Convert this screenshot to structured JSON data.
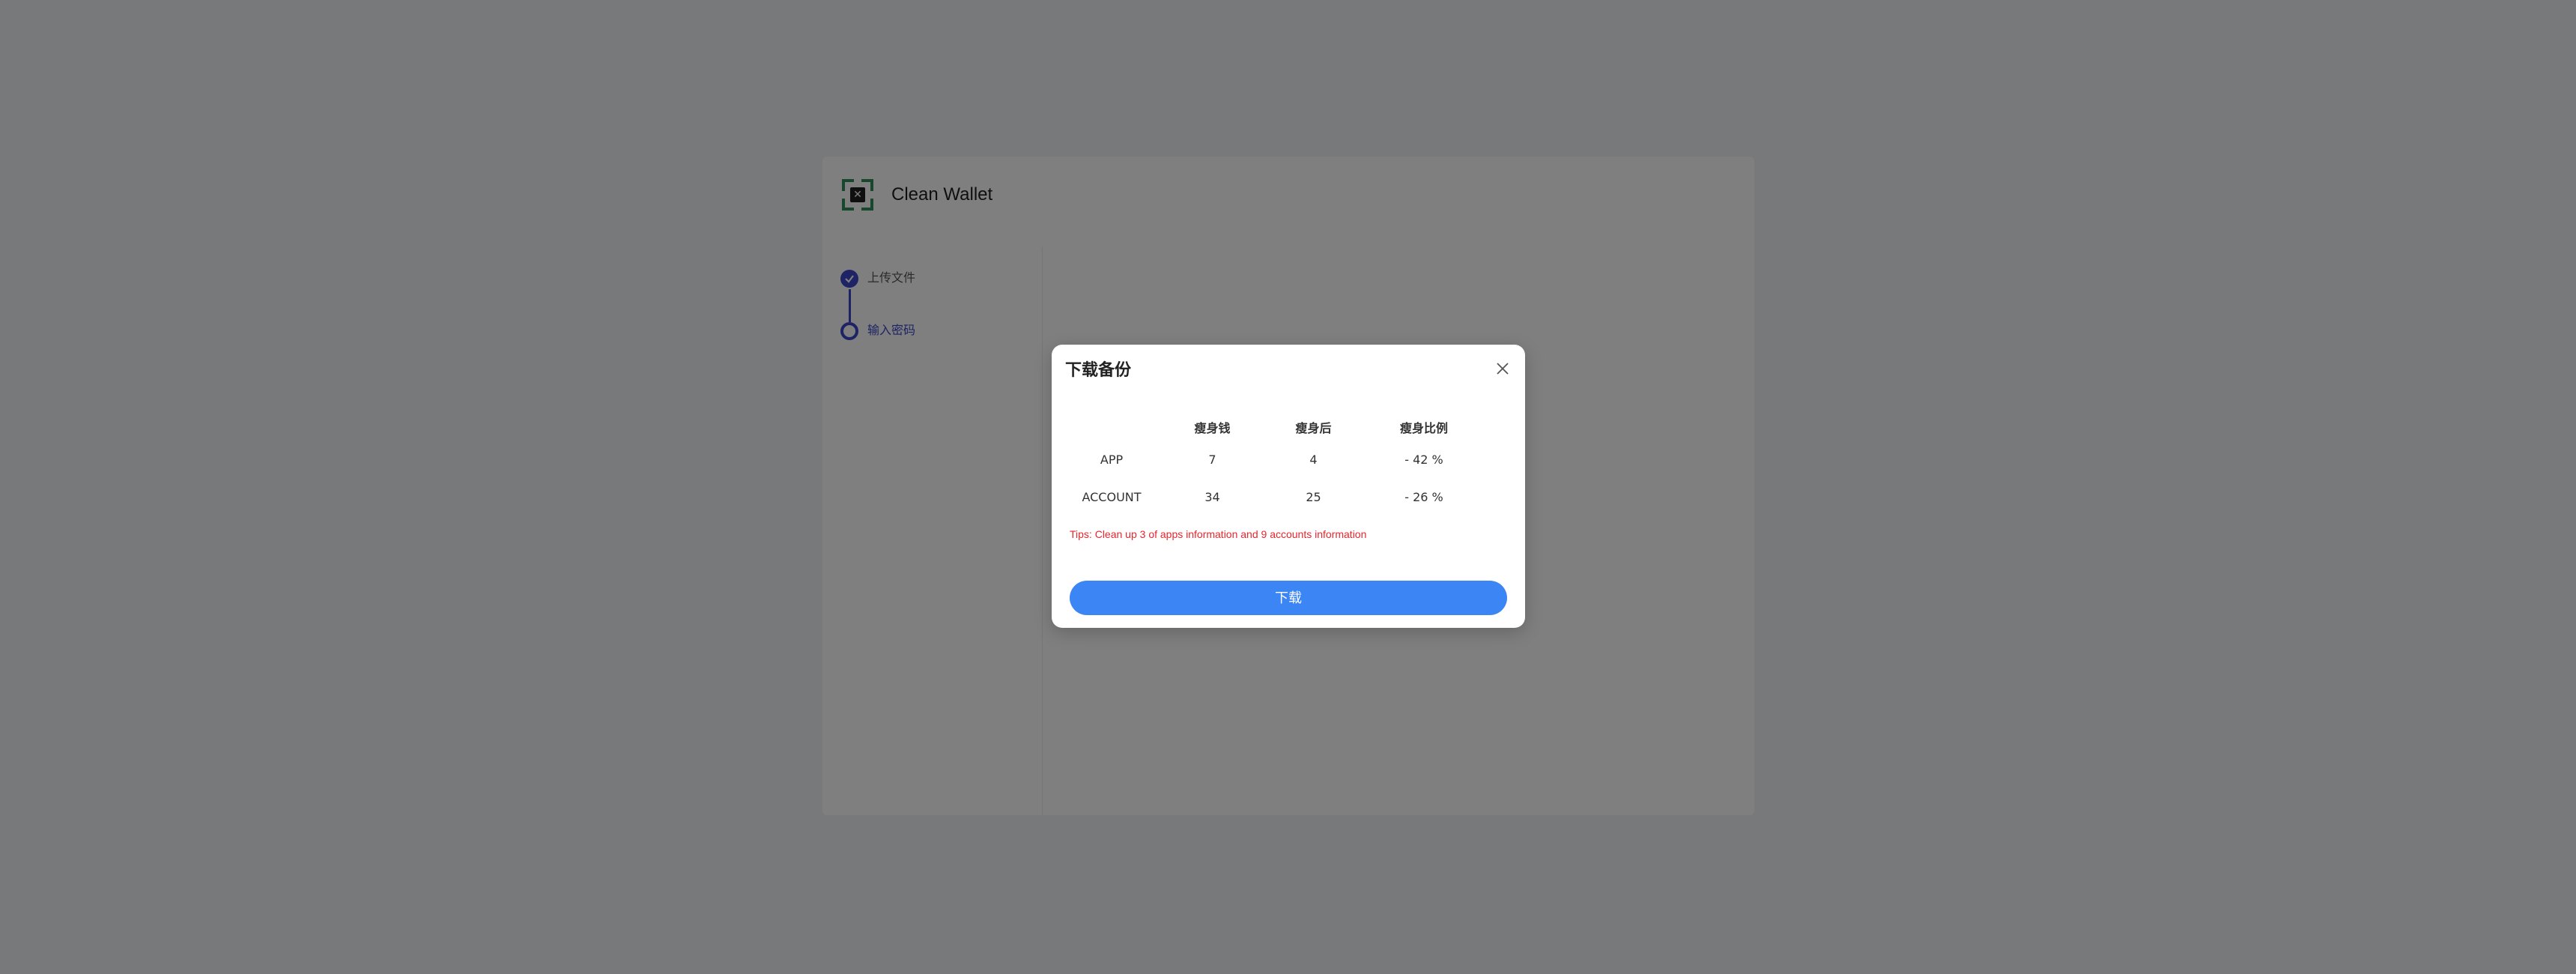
{
  "app": {
    "name": "Clean Wallet",
    "logo_icon": "wallet-logo-icon"
  },
  "steps": [
    {
      "label": "上传文件",
      "status": "done"
    },
    {
      "label": "输入密码",
      "status": "current"
    }
  ],
  "modal": {
    "title": "下载备份",
    "close_icon": "close-icon",
    "table": {
      "headers": [
        "",
        "瘦身钱",
        "瘦身后",
        "瘦身比例"
      ],
      "rows": [
        {
          "name": "APP",
          "before": "7",
          "after": "4",
          "ratio": "- 42 %"
        },
        {
          "name": "ACCOUNT",
          "before": "34",
          "after": "25",
          "ratio": "- 26 %"
        }
      ]
    },
    "tips": "Tips: Clean up 3 of apps information and 9 accounts information",
    "download_label": "下载"
  },
  "colors": {
    "primary": "#3b46c9",
    "button": "#3b85f5",
    "tips": "#e8252c",
    "logo_accent": "#2f8f5a"
  }
}
